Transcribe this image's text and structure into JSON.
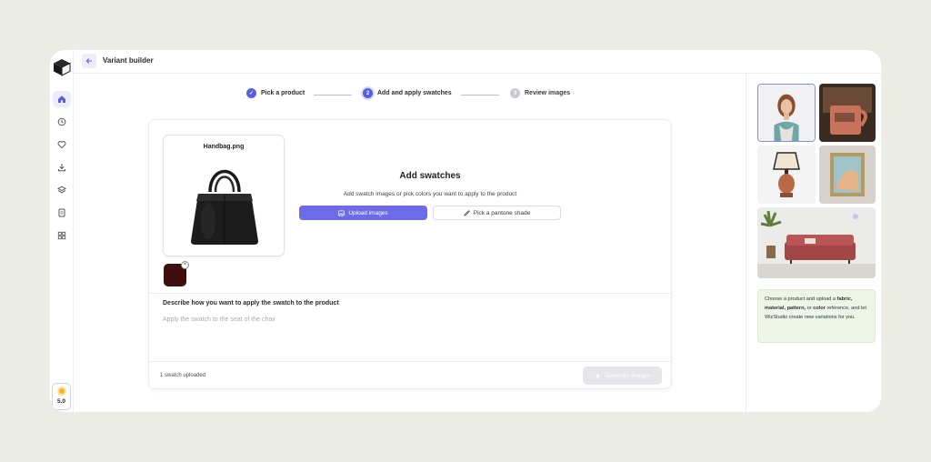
{
  "header": {
    "title": "Variant builder"
  },
  "rail": {
    "items": [
      "home-icon",
      "clock-icon",
      "heart-icon",
      "download-icon",
      "layers-icon",
      "document-icon",
      "grid-icon"
    ],
    "credits": "5.0"
  },
  "steps": [
    {
      "label": "Pick a product",
      "marker": "✓",
      "state": "done"
    },
    {
      "label": "Add and apply swatches",
      "marker": "2",
      "state": "current"
    },
    {
      "label": "Review images",
      "marker": "3",
      "state": "todo"
    }
  ],
  "product": {
    "filename": "Handbag.png"
  },
  "swatches": {
    "title": "Add swatches",
    "subtitle": "Add swatch images or pick colors you want to apply to the product",
    "upload_label": "Upload images",
    "pantone_label": "Pick a pantone shade",
    "swatch_color": "#3f0f10"
  },
  "describe": {
    "label": "Describe how you want to apply the swatch to the product",
    "placeholder": "Apply the swatch to the seat of the chair"
  },
  "footer": {
    "status": "1 swatch uploaded",
    "generate_label": "Generate images"
  },
  "tip": {
    "prefix": "Choose a product and upload a",
    "bold1": "fabric, material, pattern,",
    "or": "or",
    "bold2": "color",
    "suffix": "reference, and let WizStudio create new variations for you."
  },
  "colors": {
    "accent": "#5a5ee0",
    "button": "#6d6be6",
    "tip_bg": "#ecf5e6",
    "background": "#ecece6"
  }
}
